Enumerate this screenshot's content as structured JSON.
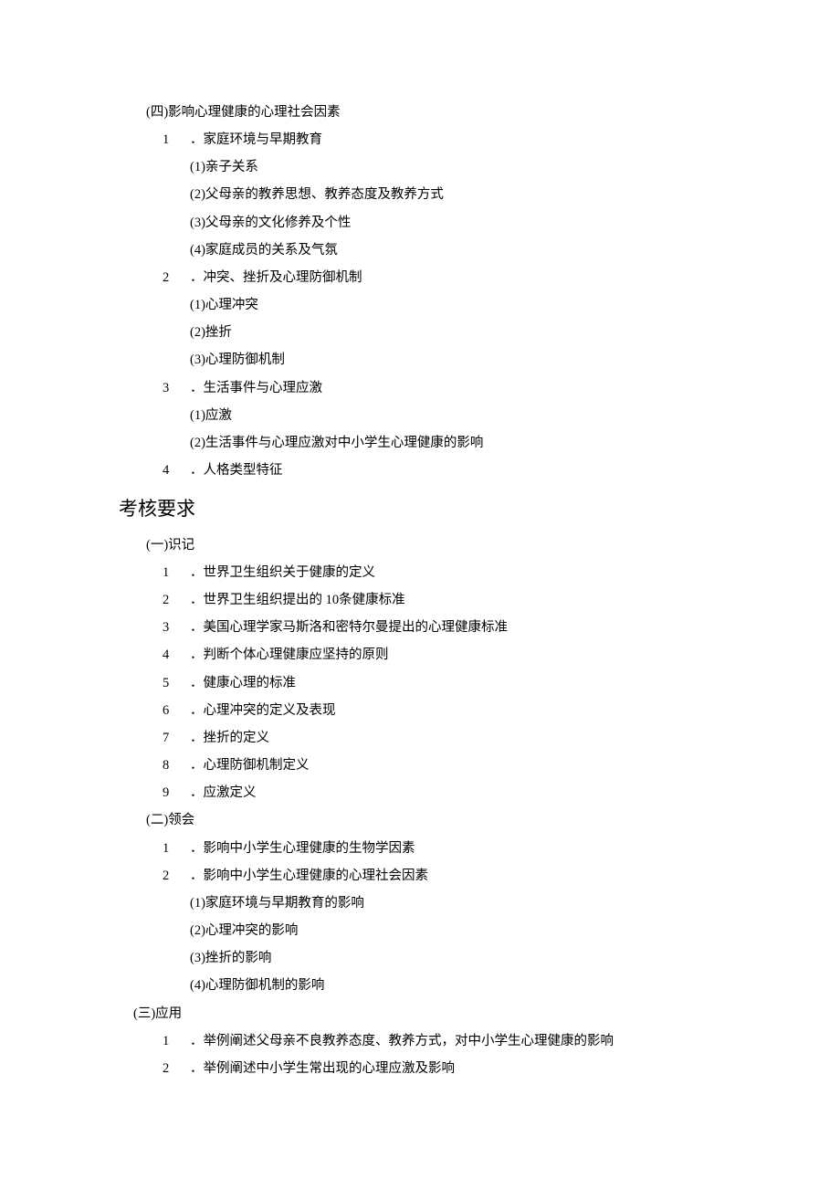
{
  "section4": {
    "title": "(四)影响心理健康的心理社会因素",
    "items": [
      {
        "num": "1",
        "label": "．家庭环境与早期教育",
        "sub": [
          "(1)亲子关系",
          "(2)父母亲的教养思想、教养态度及教养方式",
          "(3)父母亲的文化修养及个性",
          "(4)家庭成员的关系及气氛"
        ]
      },
      {
        "num": "2",
        "label": "．冲突、挫折及心理防御机制",
        "sub": [
          "(1)心理冲突",
          "(2)挫折",
          "(3)心理防御机制"
        ]
      },
      {
        "num": "3",
        "label": "．生活事件与心理应激",
        "sub": [
          "(1)应激",
          "(2)生活事件与心理应激对中小学生心理健康的影响"
        ]
      },
      {
        "num": "4",
        "label": "．人格类型特征",
        "sub": []
      }
    ]
  },
  "exam": {
    "heading": "考核要求",
    "groups": [
      {
        "title": "(一)识记",
        "items": [
          {
            "num": "1",
            "label": "．世界卫生组织关于健康的定义"
          },
          {
            "num": "2",
            "label": "．世界卫生组织提出的 10条健康标准"
          },
          {
            "num": "3",
            "label": "．美国心理学家马斯洛和密特尔曼提出的心理健康标准"
          },
          {
            "num": "4",
            "label": "．判断个体心理健康应坚持的原则"
          },
          {
            "num": "5",
            "label": "．健康心理的标准"
          },
          {
            "num": "6",
            "label": "．心理冲突的定义及表现"
          },
          {
            "num": "7",
            "label": "．挫折的定义"
          },
          {
            "num": "8",
            "label": "．心理防御机制定义"
          },
          {
            "num": "9",
            "label": "．应激定义"
          }
        ]
      },
      {
        "title": "(二)领会",
        "items": [
          {
            "num": "1",
            "label": "．影响中小学生心理健康的生物学因素"
          },
          {
            "num": "2",
            "label": "．影响中小学生心理健康的心理社会因素",
            "sub": [
              "(1)家庭环境与早期教育的影响",
              "(2)心理冲突的影响",
              "(3)挫折的影响",
              "(4)心理防御机制的影响"
            ]
          }
        ]
      },
      {
        "title": "(三)应用",
        "items": [
          {
            "num": "1",
            "label": "．举例阐述父母亲不良教养态度、教养方式，对中小学生心理健康的影响"
          },
          {
            "num": "2",
            "label": "．举例阐述中小学生常出现的心理应激及影响"
          }
        ]
      }
    ]
  }
}
